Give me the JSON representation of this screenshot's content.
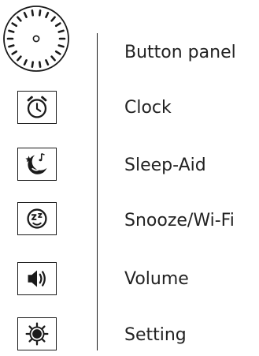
{
  "legend": {
    "items": [
      {
        "id": "button-panel",
        "label": "Button panel",
        "icon": "dial-knob-icon"
      },
      {
        "id": "clock",
        "label": "Clock",
        "icon": "alarm-clock-icon"
      },
      {
        "id": "sleep-aid",
        "label": "Sleep-Aid",
        "icon": "moon-music-icon"
      },
      {
        "id": "snooze-wifi",
        "label": "Snooze/Wi-Fi",
        "icon": "snooze-face-icon"
      },
      {
        "id": "volume",
        "label": "Volume",
        "icon": "speaker-icon"
      },
      {
        "id": "setting",
        "label": "Setting",
        "icon": "gear-sun-icon"
      }
    ]
  },
  "colors": {
    "ink": "#1a1a1a",
    "text": "#222222"
  }
}
